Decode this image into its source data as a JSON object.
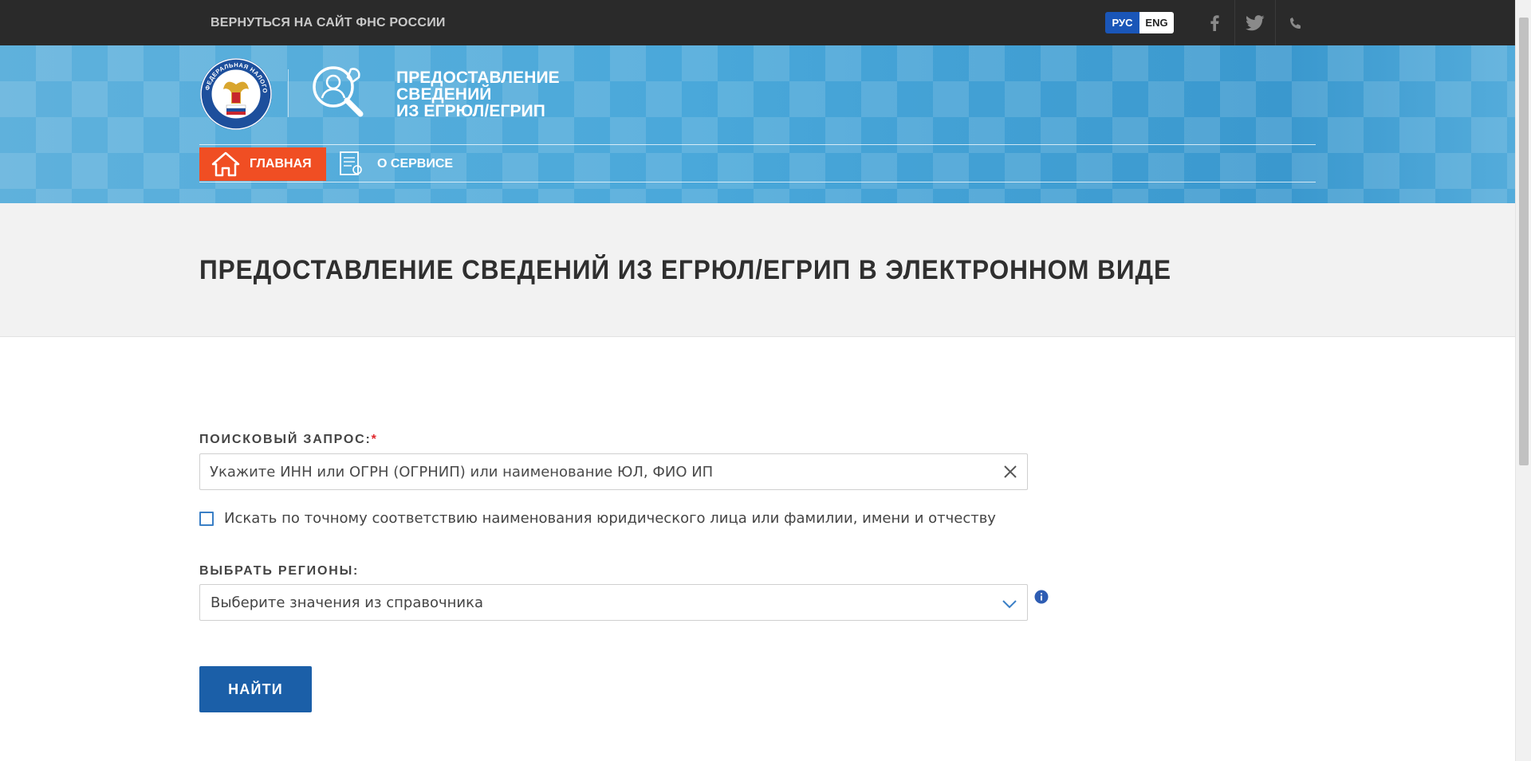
{
  "topbar": {
    "back_link": "ВЕРНУТЬСЯ НА САЙТ ФНС РОССИИ",
    "lang_ru": "РУС",
    "lang_en": "ENG",
    "social_icons": [
      "facebook-icon",
      "twitter-icon",
      "phone-icon"
    ]
  },
  "header": {
    "emblem_text": "ФЕДЕРАЛЬНАЯ НАЛОГОВАЯ СЛУЖБА",
    "service_title_lines": [
      "ПРЕДОСТАВЛЕНИЕ",
      "СВЕДЕНИЙ",
      "ИЗ ЕГРЮЛ/ЕГРИП"
    ],
    "nav": [
      {
        "label": "ГЛАВНАЯ",
        "icon": "home-icon",
        "active": true
      },
      {
        "label": "О СЕРВИСЕ",
        "icon": "document-icon",
        "active": false
      }
    ]
  },
  "main": {
    "page_title": "ПРЕДОСТАВЛЕНИЕ СВЕДЕНИЙ ИЗ ЕГРЮЛ/ЕГРИП В ЭЛЕКТРОННОМ ВИДЕ"
  },
  "form": {
    "query_label": "ПОИСКОВЫЙ ЗАПРОС:",
    "required_mark": "*",
    "query_placeholder": "Укажите ИНН или ОГРН (ОГРНИП) или наименование ЮЛ, ФИО ИП",
    "query_value": "",
    "exact_match_label": "Искать по точному соответствию наименования юридического лица или фамилии, имени и отчеству",
    "exact_match_checked": false,
    "region_label": "ВЫБРАТЬ РЕГИОНЫ:",
    "region_placeholder": "Выберите значения из справочника",
    "submit_label": "НАЙТИ"
  },
  "colors": {
    "topbar_bg": "#2a2a2a",
    "banner_blue": "#4aa8da",
    "nav_active": "#f04e23",
    "lang_active": "#1a56b8",
    "button_bg": "#1b5fa8",
    "required": "#e0262b"
  }
}
